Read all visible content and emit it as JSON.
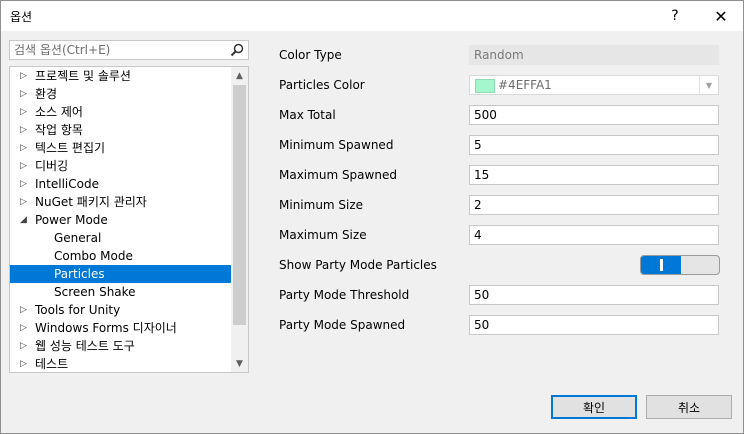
{
  "window": {
    "title": "옵션",
    "help_glyph": "?",
    "close_glyph": "✕"
  },
  "search": {
    "placeholder": "검색 옵션(Ctrl+E)"
  },
  "tree": {
    "items": [
      {
        "label": "프로젝트 및 솔루션",
        "level": 0,
        "arrow": "▷"
      },
      {
        "label": "환경",
        "level": 0,
        "arrow": "▷"
      },
      {
        "label": "소스 제어",
        "level": 0,
        "arrow": "▷"
      },
      {
        "label": "작업 항목",
        "level": 0,
        "arrow": "▷"
      },
      {
        "label": "텍스트 편집기",
        "level": 0,
        "arrow": "▷"
      },
      {
        "label": "디버깅",
        "level": 0,
        "arrow": "▷"
      },
      {
        "label": "IntelliCode",
        "level": 0,
        "arrow": "▷"
      },
      {
        "label": "NuGet 패키지 관리자",
        "level": 0,
        "arrow": "▷"
      },
      {
        "label": "Power Mode",
        "level": 0,
        "arrow": "◢"
      },
      {
        "label": "General",
        "level": 1,
        "arrow": ""
      },
      {
        "label": "Combo Mode",
        "level": 1,
        "arrow": ""
      },
      {
        "label": "Particles",
        "level": 1,
        "arrow": "",
        "selected": true
      },
      {
        "label": "Screen Shake",
        "level": 1,
        "arrow": ""
      },
      {
        "label": "Tools for Unity",
        "level": 0,
        "arrow": "▷"
      },
      {
        "label": "Windows Forms 디자이너",
        "level": 0,
        "arrow": "▷"
      },
      {
        "label": "웹 성능 테스트 도구",
        "level": 0,
        "arrow": "▷"
      },
      {
        "label": "테스트",
        "level": 0,
        "arrow": "▷"
      }
    ],
    "scroll_up_glyph": "▲",
    "scroll_down_glyph": "▼"
  },
  "properties": {
    "color_type": {
      "label": "Color Type",
      "value": "Random"
    },
    "particles_color": {
      "label": "Particles Color",
      "value": "#4EFFA1",
      "swatch": "#a6f6cd"
    },
    "max_total": {
      "label": "Max Total",
      "value": "500"
    },
    "minimum_spawned": {
      "label": "Minimum Spawned",
      "value": "5"
    },
    "maximum_spawned": {
      "label": "Maximum Spawned",
      "value": "15"
    },
    "minimum_size": {
      "label": "Minimum Size",
      "value": "2"
    },
    "maximum_size": {
      "label": "Maximum Size",
      "value": "4"
    },
    "show_party_mode": {
      "label": "Show Party Mode Particles",
      "on": true
    },
    "party_mode_threshold": {
      "label": "Party Mode Threshold",
      "value": "50"
    },
    "party_mode_spawned": {
      "label": "Party Mode Spawned",
      "value": "50"
    }
  },
  "buttons": {
    "ok": "확인",
    "cancel": "취소"
  },
  "colors": {
    "accent": "#0078d7",
    "background": "#f0f0f0"
  }
}
